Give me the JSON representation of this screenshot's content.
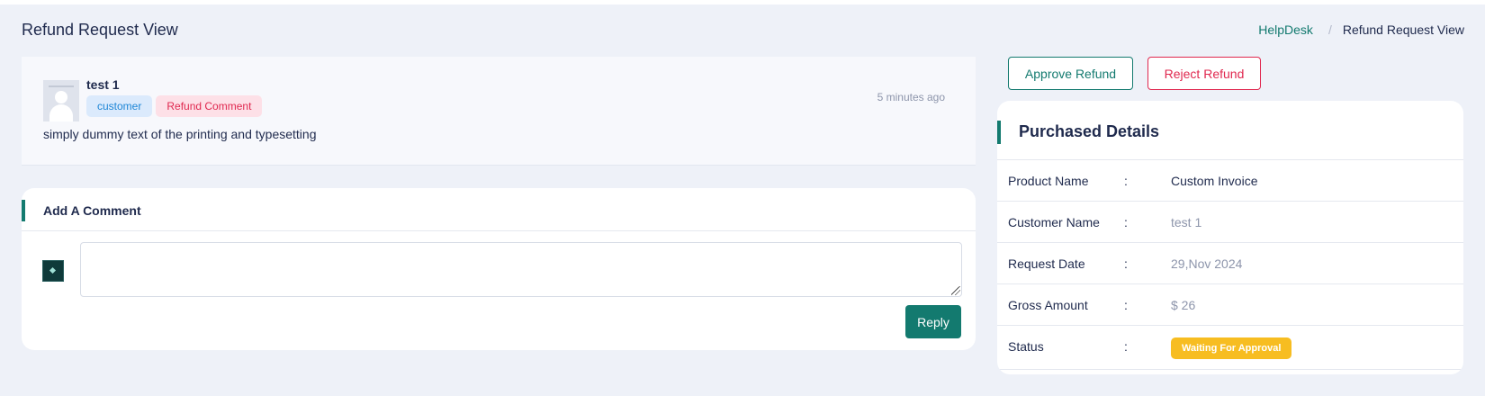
{
  "header": {
    "page_title": "Refund Request View",
    "breadcrumb": {
      "link": "HelpDesk",
      "separator": "/",
      "current": "Refund Request View"
    }
  },
  "comment": {
    "author": "test 1",
    "badges": {
      "role": "customer",
      "type": "Refund Comment"
    },
    "time": "5 minutes ago",
    "text": "simply dummy text of the printing and typesetting"
  },
  "add_comment": {
    "title": "Add A Comment",
    "input_value": "",
    "reply_label": "Reply"
  },
  "actions": {
    "approve_label": "Approve Refund",
    "reject_label": "Reject Refund"
  },
  "purchased_details": {
    "title": "Purchased Details",
    "separator": ":",
    "rows": [
      {
        "label": "Product Name",
        "value": "Custom Invoice"
      },
      {
        "label": "Customer Name",
        "value": "test 1"
      },
      {
        "label": "Request Date",
        "value": "29,Nov 2024"
      },
      {
        "label": "Gross Amount",
        "value": "$ 26"
      },
      {
        "label": "Status",
        "value": "Waiting For Approval"
      }
    ]
  },
  "colors": {
    "accent": "#137a6f",
    "danger": "#e0284f",
    "info": "#1e86d6",
    "warning": "#f7bd21",
    "background": "#eef1f8"
  },
  "icons": {
    "author_avatar": "user-avatar-icon",
    "current_user_avatar": "current-user-avatar-icon"
  }
}
